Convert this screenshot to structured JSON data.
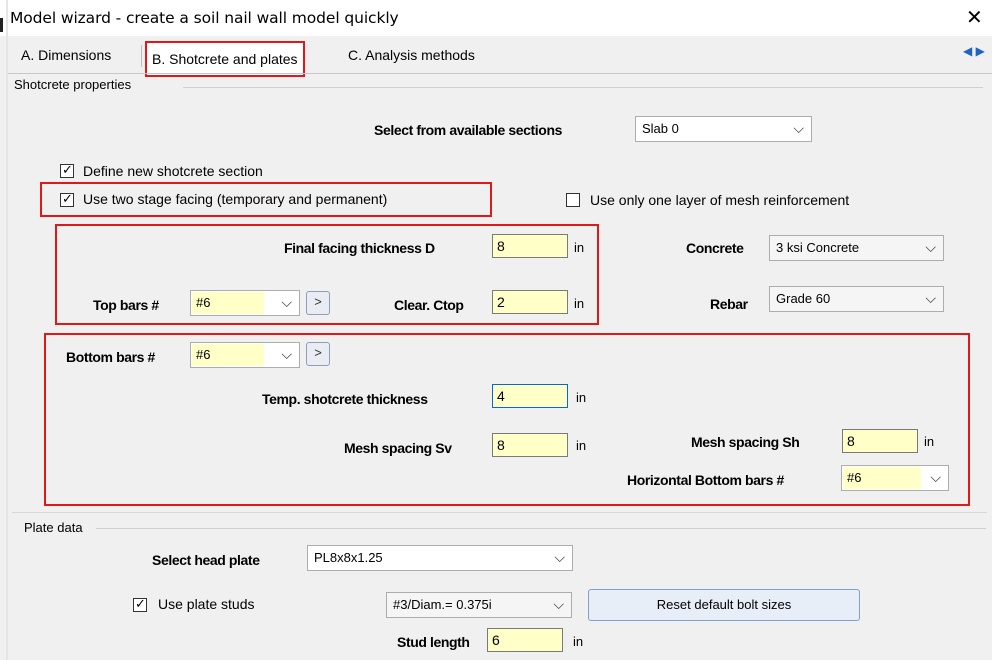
{
  "window": {
    "title": "Model wizard - create a soil nail wall model quickly",
    "close_glyph": "✕"
  },
  "tabs": [
    {
      "label": "A. Dimensions",
      "selected": false
    },
    {
      "label": "B. Shotcrete and plates",
      "selected": true
    },
    {
      "label": "C. Analysis methods",
      "selected": false
    }
  ],
  "tab_scroll": "◀ ▶",
  "shotcrete": {
    "group_label": "Shotcrete properties",
    "select_sections_label": "Select from available sections",
    "select_sections_value": "Slab 0",
    "define_new_label": "Define new shotcrete section",
    "define_new_checked": true,
    "two_stage_label": "Use two stage facing (temporary and permanent)",
    "two_stage_checked": true,
    "one_layer_label": "Use only one layer of mesh reinforcement",
    "one_layer_checked": false,
    "final_thickness_label": "Final facing thickness D",
    "final_thickness_value": "8",
    "final_thickness_unit": "in",
    "concrete_label": "Concrete",
    "concrete_value": "3 ksi Concrete",
    "top_bars_label": "Top bars #",
    "top_bars_value": "#6",
    "top_bars_btn": ">",
    "clear_ctop_label": "Clear. Ctop",
    "clear_ctop_value": "2",
    "clear_ctop_unit": "in",
    "rebar_label": "Rebar",
    "rebar_value": "Grade 60",
    "bottom_bars_label": "Bottom bars #",
    "bottom_bars_value": "#6",
    "bottom_bars_btn": ">",
    "temp_thickness_label": "Temp. shotcrete thickness",
    "temp_thickness_value": "4",
    "temp_thickness_unit": "in",
    "mesh_sv_label": "Mesh spacing Sv",
    "mesh_sv_value": "8",
    "mesh_sv_unit": "in",
    "mesh_sh_label": "Mesh spacing Sh",
    "mesh_sh_value": "8",
    "mesh_sh_unit": "in",
    "horiz_bottom_label": "Horizontal Bottom bars #",
    "horiz_bottom_value": "#6"
  },
  "plate": {
    "group_label": "Plate data",
    "head_plate_label": "Select head plate",
    "head_plate_value": "PL8x8x1.25",
    "use_studs_label": "Use plate studs",
    "use_studs_checked": true,
    "stud_size_value": "#3/Diam.= 0.375i",
    "reset_label": "Reset default bolt sizes",
    "stud_length_label": "Stud length",
    "stud_length_value": "6",
    "stud_length_unit": "in"
  },
  "colors": {
    "highlight": "#e01818",
    "input_fill": "#ffffc8",
    "focus_border": "#0a66d4"
  },
  "icons": {
    "check": "check-icon",
    "chevron": "chevron-down-icon",
    "close": "close-icon"
  }
}
